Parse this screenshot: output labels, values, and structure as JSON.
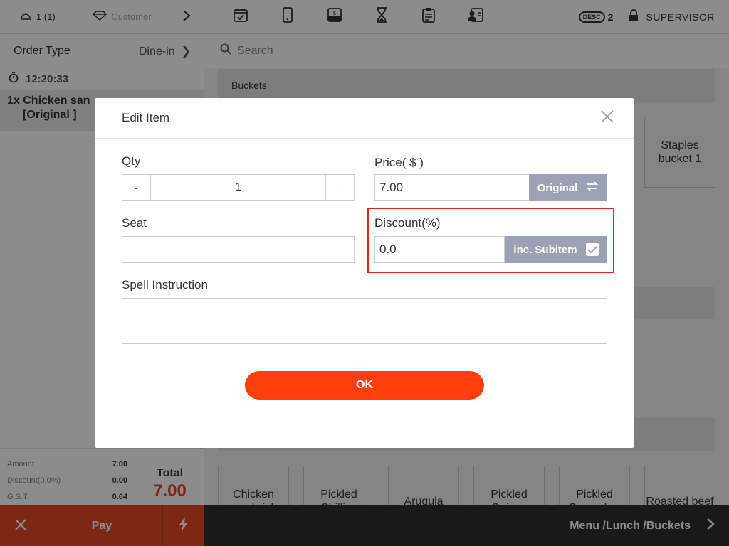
{
  "topbar": {
    "guests": "1 (1)",
    "customer": "Customer",
    "icons": [
      "calendar-check-icon",
      "tablet-icon",
      "cash-drawer-icon",
      "hourglass-icon",
      "clipboard-icon",
      "member-card-icon"
    ],
    "desc_label": "DESC",
    "desc_count": "2",
    "user": "SUPERVISOR"
  },
  "left": {
    "order_type_label": "Order Type",
    "order_type_value": "Dine-in",
    "time": "12:20:33",
    "item_line": "1x Chicken san",
    "item_mod": "[Original ]"
  },
  "totals": {
    "amount_label": "Amount",
    "amount_value": "7.00",
    "discount_label": "Discount(0.0%)",
    "discount_value": "0.00",
    "gst_label": "G.S.T.",
    "gst_value": "0.64",
    "total_label": "Total",
    "total_value": "7.00"
  },
  "bottom": {
    "pay_label": "Pay",
    "breadcrumb": "Menu /Lunch /Buckets"
  },
  "right": {
    "search_placeholder": "Search",
    "category": "Buckets",
    "tile_top": "Staples bucket  1",
    "tiles_bottom": [
      "Chicken sandwich",
      "Pickled Chillies",
      "Arugula",
      "Pickled Onions",
      "Pickled Cucumber",
      "Roasted beef"
    ]
  },
  "modal": {
    "title": "Edit Item",
    "qty_label": "Qty",
    "qty_minus": "-",
    "qty_value": "1",
    "qty_plus": "+",
    "price_label": "Price( $ )",
    "price_value": "7.00",
    "price_btn": "Original",
    "seat_label": "Seat",
    "seat_value": "",
    "discount_label": "Discount(%)",
    "discount_value": "0.0",
    "subitem_btn": "inc. Subitem",
    "spell_label": "Spell Instruction",
    "spell_value": "",
    "ok_label": "OK"
  },
  "colors": {
    "accent": "#ff3f0b",
    "pay": "#e04a25",
    "suffix_button": "#9aa2b4",
    "highlight": "#e8231a"
  }
}
